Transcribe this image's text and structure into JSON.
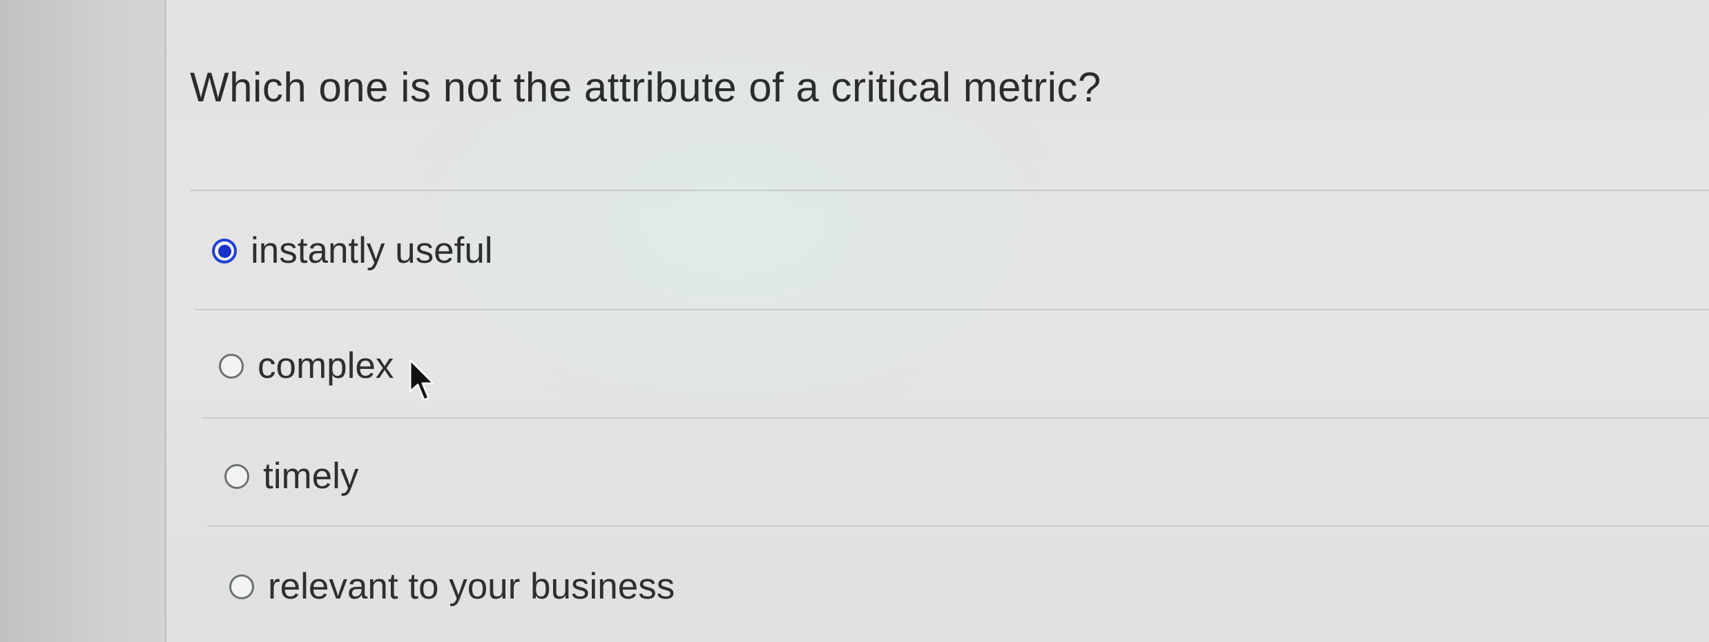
{
  "question": {
    "text": "Which one is not the attribute of a critical metric?"
  },
  "options": [
    {
      "label": "instantly useful",
      "selected": true
    },
    {
      "label": "complex",
      "selected": false
    },
    {
      "label": "timely",
      "selected": false
    },
    {
      "label": "relevant to your business",
      "selected": false
    }
  ],
  "colors": {
    "selected_radio": "#1632c7",
    "text": "#2e2f31",
    "divider": "#c9cbcc"
  },
  "icons": {
    "cursor": "mouse-pointer-arrow-icon"
  }
}
